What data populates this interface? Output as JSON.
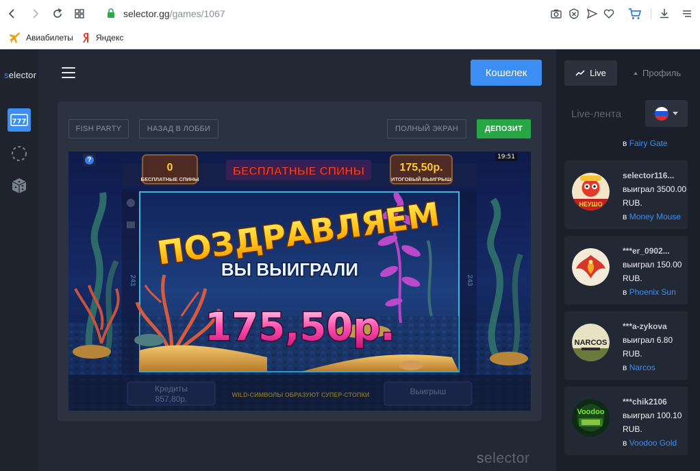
{
  "browser": {
    "url_host": "selector.gg",
    "url_path": "/games/1067",
    "bookmarks": [
      {
        "label": "Авиабилеты",
        "icon": "airplane-icon"
      },
      {
        "label": "Яндекс",
        "icon": "yandex-icon"
      }
    ]
  },
  "sidebar": {
    "logo_prefix": "s",
    "logo_rest": "elector",
    "items": [
      {
        "icon": "slots-icon",
        "active": true
      },
      {
        "icon": "spinner-icon",
        "active": false
      },
      {
        "icon": "dice-icon",
        "active": false
      }
    ]
  },
  "header": {
    "wallet_label": "Кошелек"
  },
  "game_panel": {
    "game_name": "FISH PARTY",
    "back_label": "НАЗАД В ЛОББИ",
    "fullscreen_label": "ПОЛНЫЙ ЭКРАН",
    "deposit_label": "ДЕПОЗИТ",
    "game": {
      "clock": "19:51",
      "help": "?",
      "free_spins_count": "0",
      "free_spins_label": "БЕСПЛАТНЫЕ СПИНЫ",
      "banner_title": "БЕСПЛАТНЫЕ СПИНЫ",
      "total_win_value": "175,50р.",
      "total_win_label": "ИТОГОВЫЙ ВЫИГРЫШ",
      "congrats": "ПОЗДРАВЛЯЕМ",
      "you_won": "ВЫ ВЫИГРАЛИ",
      "win_amount": "175,50р.",
      "credits_label": "Кредиты",
      "credits_value": "857,80р.",
      "wild_text": "WILD-СИМВОЛЫ ОБРАЗУЮТ СУПЕР-СТОПКИ",
      "win_label": "Выигрыш",
      "reel_digits": "243"
    }
  },
  "footer": {
    "logo_prefix": "s",
    "logo_rest": "elector"
  },
  "right": {
    "tab_live": "Live",
    "tab_profile": "Профиль",
    "live_feed_title": "Live-лента",
    "partial_prefix": "в",
    "partial_game": "Fairy Gate",
    "feed": [
      {
        "user": "selector116...",
        "won": "выиграл 3500.00 RUB.",
        "prefix": "в",
        "game": "Money Mouse",
        "avatar": "money-mouse"
      },
      {
        "user": "***er_0902...",
        "won": "выиграл 150.00 RUB.",
        "prefix": "в",
        "game": "Phoenix Sun",
        "avatar": "phoenix-sun"
      },
      {
        "user": "***a-zykova",
        "won": "выиграл 6.80 RUB.",
        "prefix": "в",
        "game": "Narcos",
        "avatar": "narcos"
      },
      {
        "user": "***chik2106",
        "won": "выиграл 100.10 RUB.",
        "prefix": "в",
        "game": "Voodoo Gold",
        "avatar": "voodoo-gold"
      }
    ],
    "avatar_labels": {
      "narcos": "NARCOS",
      "voodoo": "Voodoo",
      "money_mouse": "НЕУШО"
    }
  },
  "colors": {
    "accent_blue": "#3d8ef2",
    "deposit_green": "#27a645",
    "link_blue": "#3e8ef4"
  }
}
